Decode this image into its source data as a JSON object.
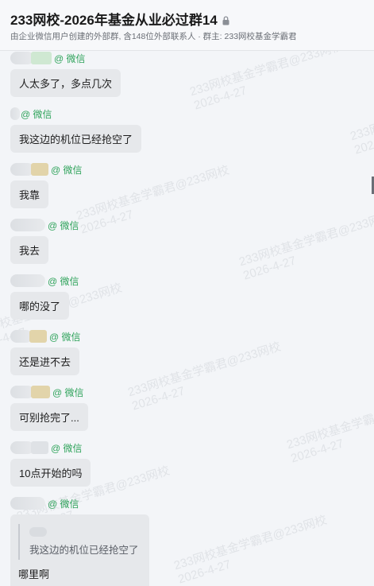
{
  "header": {
    "title": "233网校-2026年基金从业必过群14",
    "subtitle": "由企业微信用户创建的外部群, 含148位外部联系人 · 群主: 233网校基金学霸君"
  },
  "messages": [
    {
      "source": "@ 微信",
      "text": "人太多了，多点几次"
    },
    {
      "source": "@ 微信",
      "text": "我这边的机位已经抢空了"
    },
    {
      "source": "@ 微信",
      "text": "我靠"
    },
    {
      "source": "@ 微信",
      "text": "我去"
    },
    {
      "source": "@ 微信",
      "text": "哪的没了"
    },
    {
      "source": "@ 微信",
      "text": "还是进不去"
    },
    {
      "source": "@ 微信",
      "text": "可别抢完了..."
    },
    {
      "source": "@ 微信",
      "text": "10点开始的吗"
    },
    {
      "source": "@ 微信",
      "quote": "我这边的机位已经抢空了",
      "text": "哪里啊"
    }
  ],
  "watermark": {
    "line1": "233网校基金学霸君@233网校",
    "line2": "2026-4-27"
  }
}
